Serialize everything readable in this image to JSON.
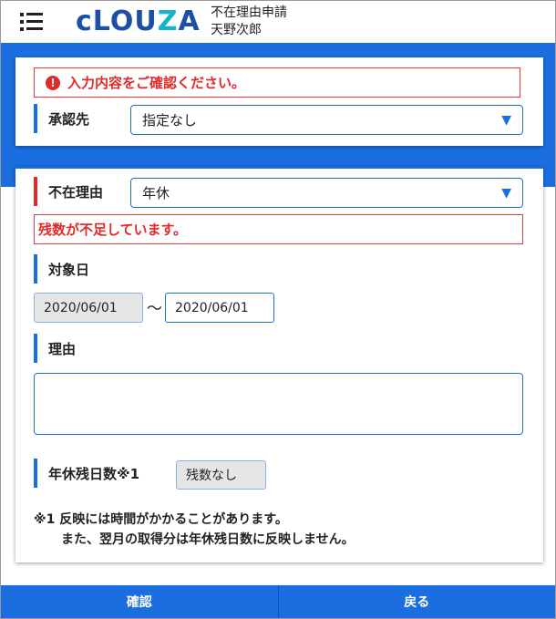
{
  "header": {
    "logo_text_1": "cLOU",
    "logo_text_2": "Z",
    "logo_text_3": "A",
    "title": "不在理由申請",
    "user_name": "天野次郎"
  },
  "approval": {
    "error_message": "入力内容をご確認ください。",
    "approver_label": "承認先",
    "approver_value": "指定なし"
  },
  "form": {
    "reason_type_label": "不在理由",
    "reason_type_value": "年休",
    "reason_type_error": "残数が不足しています。",
    "target_date_label": "対象日",
    "date_from": "2020/06/01",
    "date_separator": "〜",
    "date_to": "2020/06/01",
    "reason_label": "理由",
    "reason_value": "",
    "leave_balance_label": "年休残日数※1",
    "leave_balance_value": "残数なし",
    "note_line1": "※1 反映には時間がかかることがあります。",
    "note_line2": "また、翌月の取得分は年休残日数に反映しません。"
  },
  "footer": {
    "confirm_label": "確認",
    "back_label": "戻る"
  },
  "colors": {
    "primary": "#1a6ee0",
    "error": "#e12a2a",
    "disabled_bg": "#e6e6e6"
  },
  "icons": {
    "menu": "hamburger-menu-icon",
    "error": "exclamation-circle-icon",
    "dropdown": "triangle-down-icon"
  }
}
